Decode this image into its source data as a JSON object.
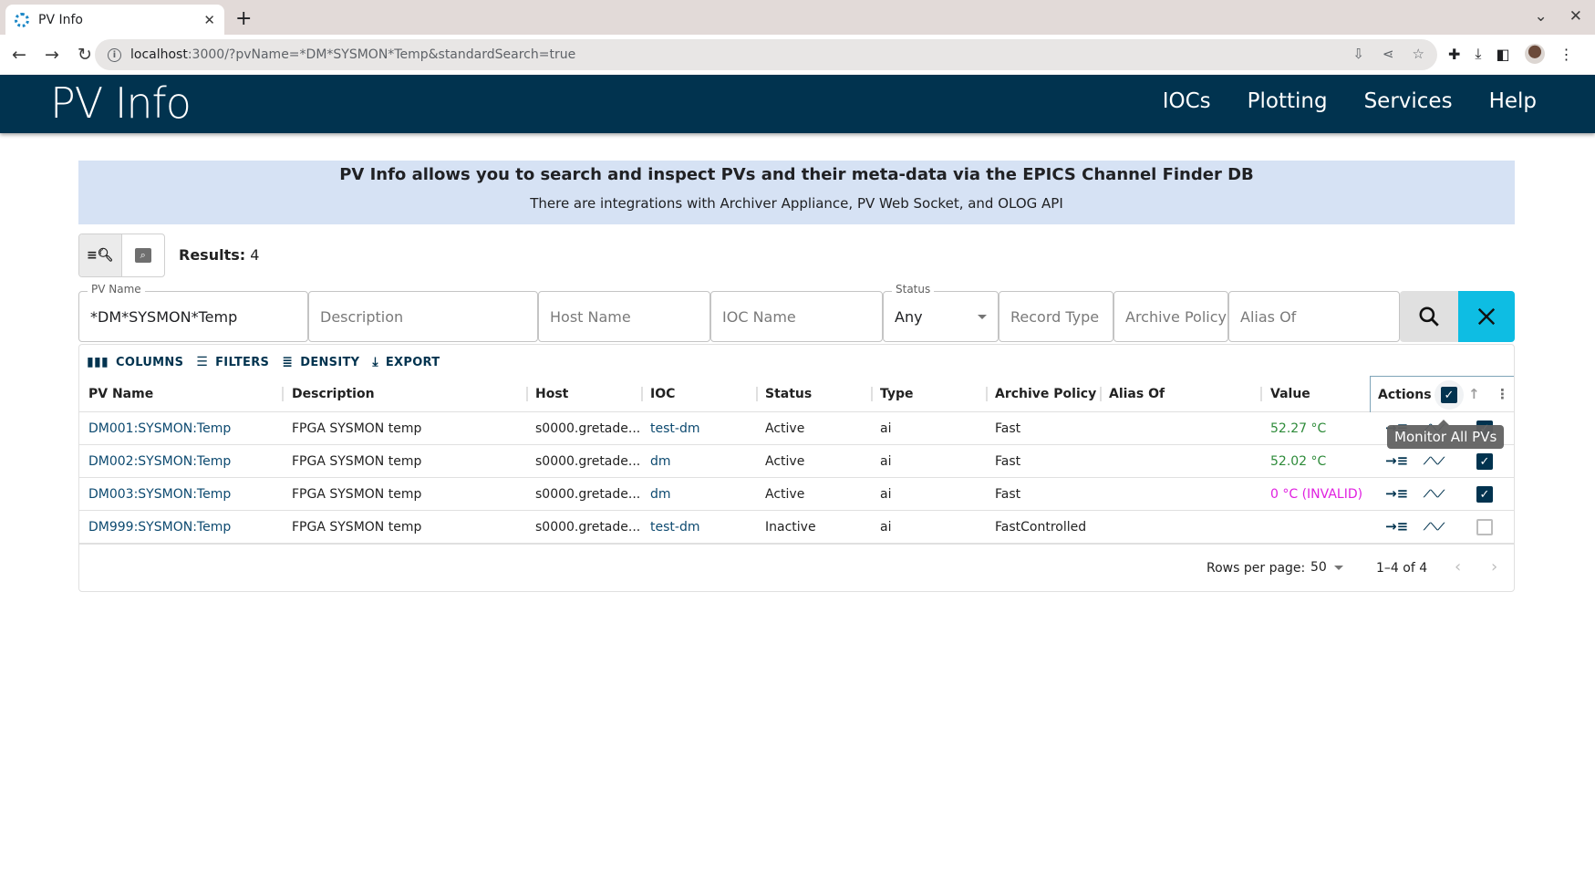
{
  "browser": {
    "tab_title": "PV Info",
    "url_host": "localhost",
    "url_rest": ":3000/?pvName=*DM*SYSMON*Temp&standardSearch=true"
  },
  "app": {
    "title": "PV Info",
    "nav": [
      "IOCs",
      "Plotting",
      "Services",
      "Help"
    ],
    "brand_color": "#01334f",
    "accent_color": "#0ebde3"
  },
  "banner": {
    "title": "PV Info allows you to search and inspect PVs and their meta-data via the EPICS Channel Finder DB",
    "subtitle": "There are integrations with Archiver Appliance, PV Web Socket, and OLOG API"
  },
  "results": {
    "label": "Results:",
    "count": "4"
  },
  "filters": {
    "pv_name": {
      "label": "PV Name",
      "value": "*DM*SYSMON*Temp"
    },
    "description": {
      "placeholder": "Description"
    },
    "host_name": {
      "placeholder": "Host Name"
    },
    "ioc_name": {
      "placeholder": "IOC Name"
    },
    "status": {
      "label": "Status",
      "value": "Any"
    },
    "record_type": {
      "placeholder": "Record Type"
    },
    "archive_policy": {
      "placeholder": "Archive Policy"
    },
    "alias_of": {
      "placeholder": "Alias Of"
    }
  },
  "grid": {
    "toolbar": [
      "COLUMNS",
      "FILTERS",
      "DENSITY",
      "EXPORT"
    ],
    "columns": [
      "PV Name",
      "Description",
      "Host",
      "IOC",
      "Status",
      "Type",
      "Archive Policy",
      "Alias Of",
      "Value",
      "Actions"
    ],
    "rows": [
      {
        "pv": "DM001:SYSMON:Temp",
        "desc": "FPGA SYSMON temp",
        "host": "s0000.gretade...",
        "ioc": "test-dm",
        "status": "Active",
        "type": "ai",
        "policy": "Fast",
        "alias": "",
        "value": "52.27 °C",
        "value_state": "ok",
        "monitored": true
      },
      {
        "pv": "DM002:SYSMON:Temp",
        "desc": "FPGA SYSMON temp",
        "host": "s0000.gretade...",
        "ioc": "dm",
        "status": "Active",
        "type": "ai",
        "policy": "Fast",
        "alias": "",
        "value": "52.02 °C",
        "value_state": "ok",
        "monitored": true
      },
      {
        "pv": "DM003:SYSMON:Temp",
        "desc": "FPGA SYSMON temp",
        "host": "s0000.gretade...",
        "ioc": "dm",
        "status": "Active",
        "type": "ai",
        "policy": "Fast",
        "alias": "",
        "value": "0 °C (INVALID)",
        "value_state": "invalid",
        "monitored": true
      },
      {
        "pv": "DM999:SYSMON:Temp",
        "desc": "FPGA SYSMON temp",
        "host": "s0000.gretade...",
        "ioc": "test-dm",
        "status": "Inactive",
        "type": "ai",
        "policy": "FastControlled",
        "alias": "",
        "value": "",
        "value_state": "none",
        "monitored": false
      }
    ],
    "tooltip": "Monitor All PVs",
    "footer": {
      "rows_per_page_label": "Rows per page:",
      "rows_per_page": "50",
      "range": "1–4 of 4"
    }
  }
}
